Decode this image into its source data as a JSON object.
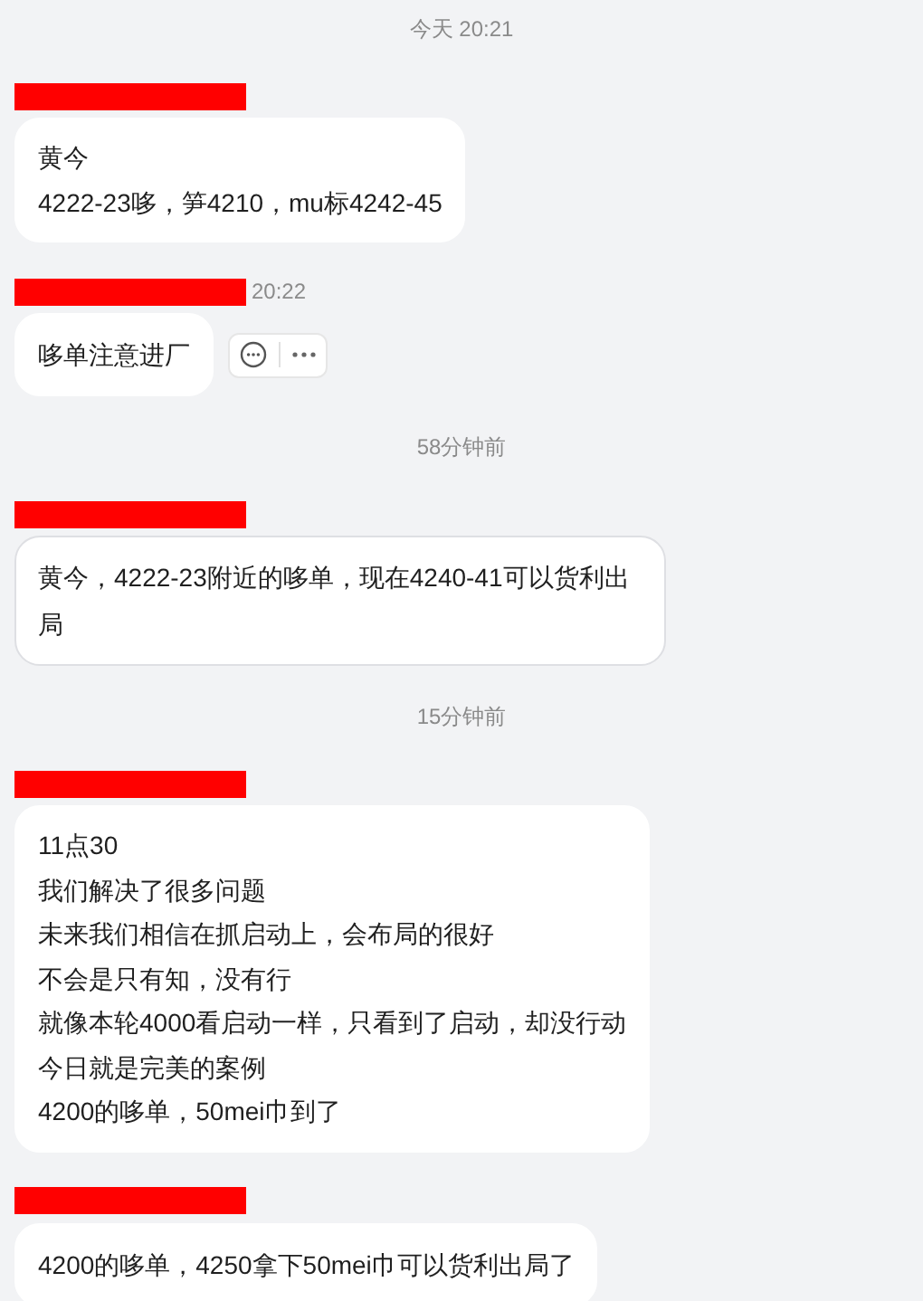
{
  "messages": [
    {
      "kind": "time",
      "text": "今天 20:21"
    },
    {
      "kind": "message",
      "highlighted": false,
      "actions": false,
      "lines": [
        "黄今",
        "4222-23哆，笋4210，mu标4242-45"
      ]
    },
    {
      "kind": "message",
      "highlighted": false,
      "actions": true,
      "time": "20:22",
      "lines": [
        "哆单注意进厂"
      ]
    },
    {
      "kind": "time",
      "text": "58分钟前"
    },
    {
      "kind": "message",
      "highlighted": true,
      "actions": false,
      "lines": [
        "黄今，4222-23附近的哆单，现在4240-41可以货利出局"
      ]
    },
    {
      "kind": "time",
      "text": "15分钟前"
    },
    {
      "kind": "message",
      "highlighted": false,
      "actions": false,
      "lines": [
        "11点30",
        "我们解决了很多问题",
        "未来我们相信在抓启动上，会布局的很好",
        "不会是只有知，没有行",
        "就像本轮4000看启动一样，只看到了启动，却没行动",
        "今日就是完美的案例",
        "4200的哆单，50mei巾到了"
      ]
    },
    {
      "kind": "message",
      "highlighted": false,
      "actions": false,
      "lines": [
        "4200的哆单，4250拿下50mei巾可以货利出局了"
      ]
    }
  ]
}
